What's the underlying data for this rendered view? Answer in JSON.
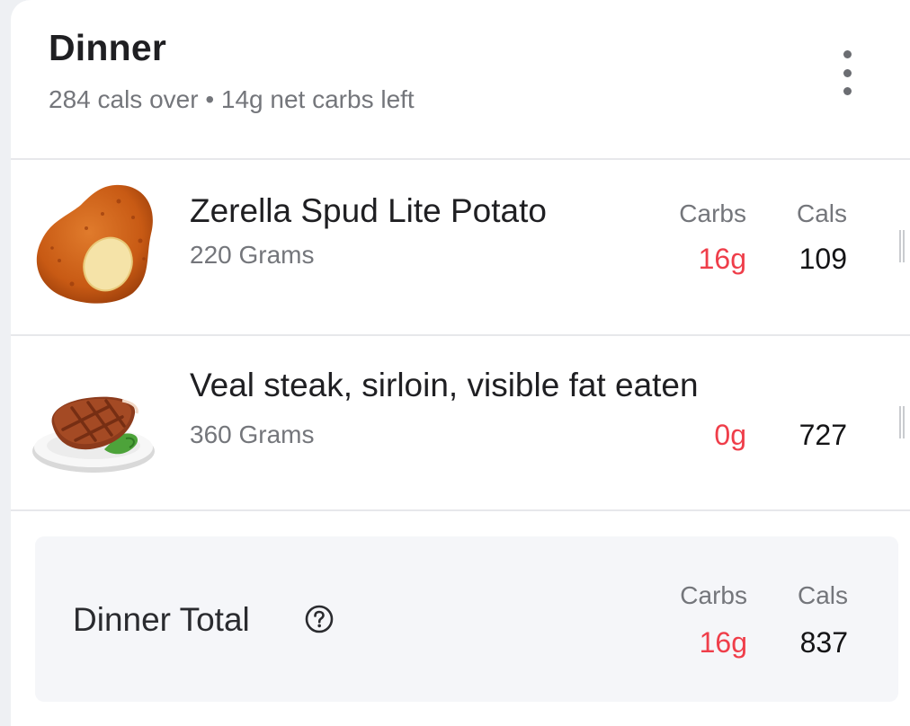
{
  "meal": {
    "title": "Dinner",
    "subtitle": "284 cals over • 14g net carbs left",
    "menu_icon": "more-vertical-icon"
  },
  "foods": [
    {
      "name": "Zerella Spud Lite Potato",
      "serving": "220 Grams",
      "carbs_label": "Carbs",
      "carbs": "16g",
      "cals_label": "Cals",
      "cals": "109",
      "icon": "potato-icon"
    },
    {
      "name": "Veal steak, sirloin, visible fat eaten",
      "serving": "360 Grams",
      "carbs": "0g",
      "cals": "727",
      "icon": "steak-icon"
    }
  ],
  "total": {
    "label": "Dinner Total",
    "carbs_label": "Carbs",
    "carbs": "16g",
    "cals_label": "Cals",
    "cals": "837",
    "help_icon": "question-circle-icon"
  },
  "colors": {
    "carbs": "#ef3e4a",
    "text": "#1f1f22",
    "muted": "#74767b"
  }
}
